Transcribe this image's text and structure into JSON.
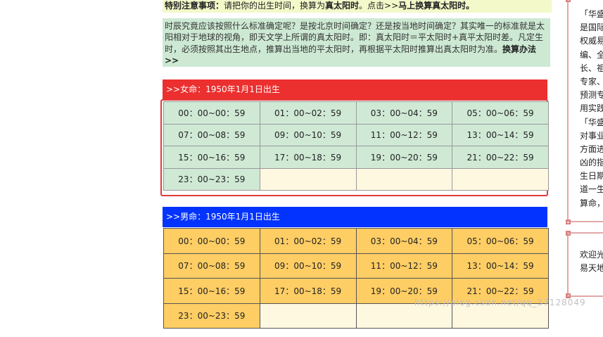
{
  "notice": {
    "label": "特别注意事项：",
    "text": "请把你的出生时间，换算为",
    "highlight": "真太阳时",
    "text2": "。点击>>",
    "link": "马上换算真太阳时。"
  },
  "explain": {
    "text": "时辰究竟应该按照什么标准确定呢？是按北京时间确定？还是按当地时间确定？其实唯一的标准就是太阳相对于地球的视角，即天文学上所谓的真太阳时。即：真太阳时＝平太阳时+真平太阳时差。凡定生时，必须按照其出生地点，推算出当地的平太阳时，再根据平太阳时推算出真太阳时为准。",
    "link": "换算办法>>"
  },
  "female": {
    "header": ">>女命：1950年1月1日出生",
    "slots": [
      [
        "00：00~00：59",
        "01：00~02：59",
        "03：00~04：59",
        "05：00~06：59"
      ],
      [
        "07：00~08：59",
        "09：00~10：59",
        "11：00~12：59",
        "13：00~14：59"
      ],
      [
        "15：00~16：59",
        "17：00~18：59",
        "19：00~20：59",
        "21：00~22：59"
      ],
      [
        "23：00~23：59",
        "",
        "",
        ""
      ]
    ]
  },
  "male": {
    "header": ">>男命：1950年1月1日出生",
    "slots": [
      [
        "00：00~00：59",
        "01：00~02：59",
        "03：00~04：59",
        "05：00~06：59"
      ],
      [
        "07：00~08：59",
        "09：00~10：59",
        "11：00~12：59",
        "13：00~14：59"
      ],
      [
        "15：00~16：59",
        "17：00~18：59",
        "19：00~20：59",
        "21：00~22：59"
      ],
      [
        "23：00~23：59",
        "",
        "",
        ""
      ]
    ]
  },
  "sidebar": {
    "box1_lines": [
      "「华盛",
      "是国际",
      "权威易",
      "编、全",
      "长、祖",
      "专家、",
      "预测专",
      "用实践",
      "「华盛",
      "对事业",
      "方面进",
      "凶的指",
      "生日期",
      "道一生",
      "算命，"
    ],
    "box2_lines": [
      "欢迎光",
      "易天地"
    ]
  },
  "watermark": "https://blog.csdn.net/qq_37128049",
  "colors": {
    "female_header": "#ec2f2f",
    "male_header": "#0233ff",
    "female_cell": "#cfe9d5",
    "male_cell": "#fecd64",
    "empty_cell": "#fff8e1",
    "notice_bg": "#f3f9c9",
    "explain_bg": "#cde9d3"
  }
}
